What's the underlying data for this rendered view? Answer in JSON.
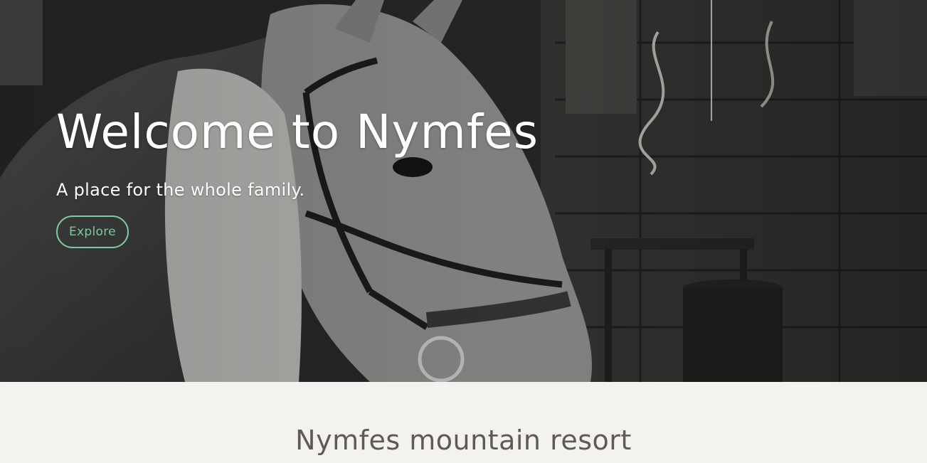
{
  "hero": {
    "title": "Welcome to Nymfes",
    "subtitle": "A place for the whole family.",
    "button_label": "Explore",
    "button_color": "#7fc79e"
  },
  "section": {
    "title": "Nymfes mountain resort"
  },
  "colors": {
    "section_background": "#f3f2ee",
    "section_title": "#5e5a55"
  }
}
